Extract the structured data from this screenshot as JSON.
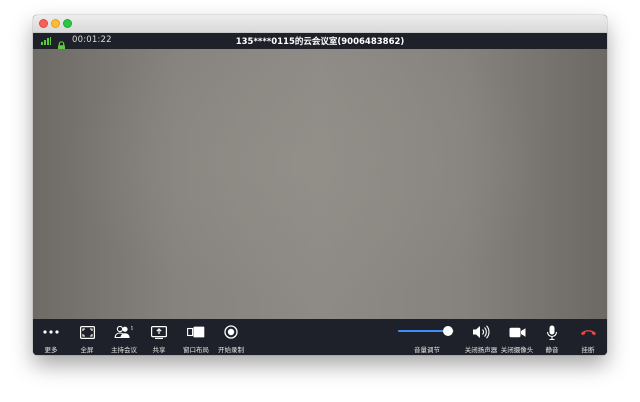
{
  "status_bar": {
    "timer": "00:01:22",
    "room_title": "135****0115的云会议室(9006483862)"
  },
  "toolbar": {
    "left": [
      {
        "label": "更多",
        "icon": "more-dots-icon"
      },
      {
        "label": "全屏",
        "icon": "fullscreen-icon"
      },
      {
        "label": "主持会议",
        "icon": "participants-icon",
        "badge": "1"
      },
      {
        "label": "共享",
        "icon": "share-screen-icon"
      },
      {
        "label": "窗口布局",
        "icon": "window-layout-icon"
      },
      {
        "label": "开始录制",
        "icon": "record-icon"
      }
    ],
    "volume": {
      "label": "音量调节",
      "level": 0.9
    },
    "right": [
      {
        "label": "关闭扬声器",
        "icon": "speaker-icon"
      },
      {
        "label": "关闭摄像头",
        "icon": "camera-icon"
      },
      {
        "label": "静音",
        "icon": "microphone-icon"
      },
      {
        "label": "挂断",
        "icon": "hang-up-icon"
      }
    ]
  },
  "colors": {
    "accent": "#3d8df5",
    "hangup": "#e8473c",
    "signal": "#5ecb3d",
    "bar": "#1e2129"
  }
}
